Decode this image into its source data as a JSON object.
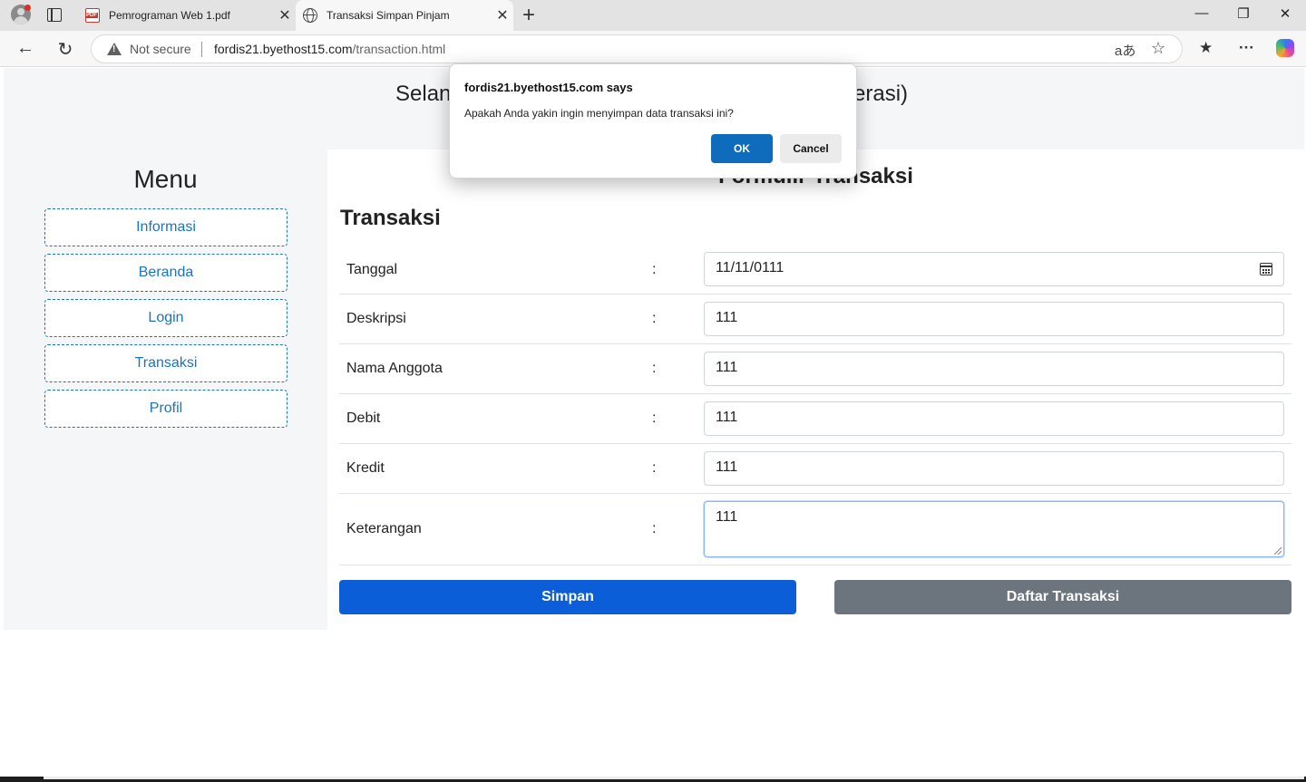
{
  "browser": {
    "tabs": [
      {
        "title": "Pemrograman Web 1.pdf"
      },
      {
        "title": "Transaksi Simpan Pinjam"
      }
    ],
    "address": {
      "security_label": "Not secure",
      "host": "fordis21.byethost15.com",
      "path": "/transaction.html"
    },
    "icons": {
      "back": "←",
      "reload": "↻",
      "new_tab": "+",
      "close": "✕",
      "minimize": "—",
      "restore": "❐",
      "window_close": "✕",
      "translate": "aあ",
      "star": "☆",
      "favorites": "★",
      "more": "···"
    }
  },
  "page": {
    "header_title_left": "Selan",
    "header_title_right": "erasi)",
    "menu": {
      "title": "Menu",
      "items": [
        {
          "label": "Informasi"
        },
        {
          "label": "Beranda"
        },
        {
          "label": "Login"
        },
        {
          "label": "Transaksi"
        },
        {
          "label": "Profil"
        }
      ]
    },
    "form": {
      "title": "Formulir Transaksi",
      "section_title": "Transaksi",
      "colon": ":",
      "fields": [
        {
          "label": "Tanggal",
          "value": "11/11/0111"
        },
        {
          "label": "Deskripsi",
          "value": "111"
        },
        {
          "label": "Nama Anggota",
          "value": "111"
        },
        {
          "label": "Debit",
          "value": "111"
        },
        {
          "label": "Kredit",
          "value": "111"
        },
        {
          "label": "Keterangan",
          "value": "111"
        }
      ],
      "save_label": "Simpan",
      "list_label": "Daftar Transaksi"
    }
  },
  "dialog": {
    "origin": "fordis21.byethost15.com says",
    "message": "Apakah Anda yakin ingin menyimpan data transaksi ini?",
    "ok_label": "OK",
    "cancel_label": "Cancel"
  },
  "colors": {
    "primary": "#0b5ed7",
    "secondary": "#6c757d",
    "menu_link": "#1a73c9",
    "dialog_ok": "#0f6cbd"
  }
}
